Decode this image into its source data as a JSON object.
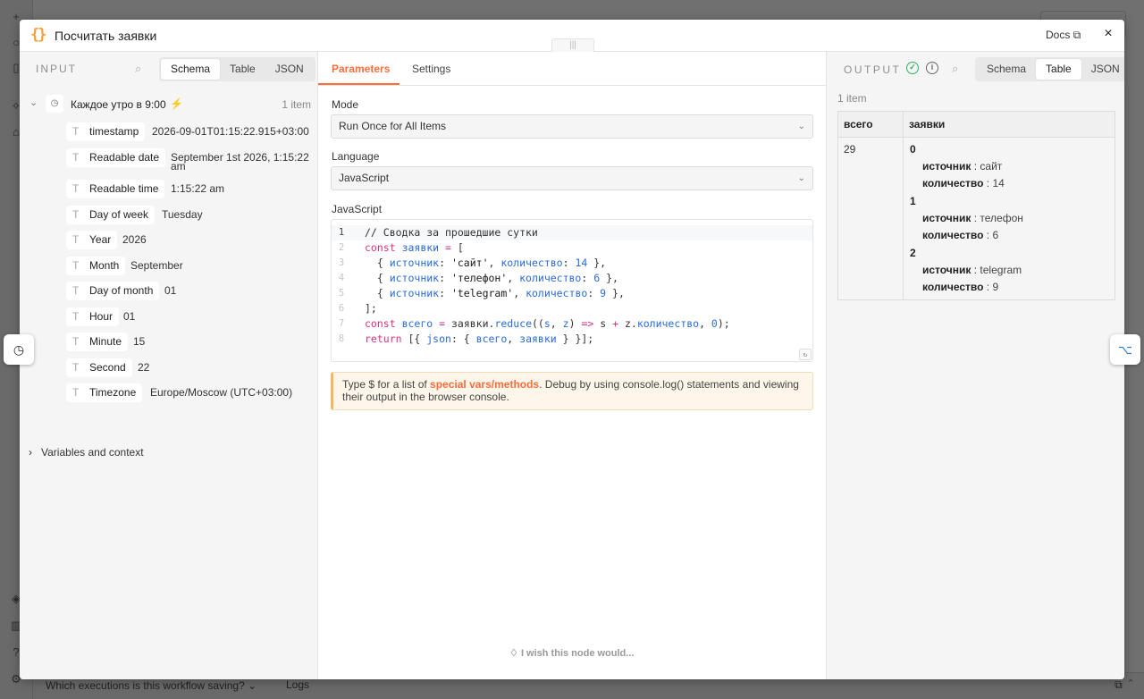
{
  "background": {
    "bottom_bar": {
      "executions_select": "Which executions is this workflow saving?",
      "logs_label": "Logs"
    }
  },
  "modal": {
    "node_icon": "{}",
    "title": "Посчитать заявки",
    "docs_label": "Docs",
    "close_icon": "×"
  },
  "input": {
    "label": "INPUT",
    "view_tabs": [
      "Schema",
      "Table",
      "JSON"
    ],
    "active_view": "Schema",
    "trigger": {
      "name": "Каждое утро в 9:00",
      "count": "1 item"
    },
    "fields": [
      {
        "key": "timestamp",
        "value": "2026-09-01T01:15:22.915+03:00"
      },
      {
        "key": "Readable date",
        "value": "September 1st 2026, 1:15:22",
        "value2": "am"
      },
      {
        "key": "Readable time",
        "value": "1:15:22 am"
      },
      {
        "key": "Day of week",
        "value": "Tuesday"
      },
      {
        "key": "Year",
        "value": "2026"
      },
      {
        "key": "Month",
        "value": "September"
      },
      {
        "key": "Day of month",
        "value": "01"
      },
      {
        "key": "Hour",
        "value": "01"
      },
      {
        "key": "Minute",
        "value": "15"
      },
      {
        "key": "Second",
        "value": "22"
      },
      {
        "key": "Timezone",
        "value": "Europe/Moscow (UTC+03:00)"
      }
    ],
    "variables_label": "Variables and context"
  },
  "params": {
    "tabs": [
      "Parameters",
      "Settings"
    ],
    "active_tab": "Parameters",
    "mode_label": "Mode",
    "mode_value": "Run Once for All Items",
    "language_label": "Language",
    "language_value": "JavaScript",
    "code_label": "JavaScript",
    "code_lines": [
      "// Сводка за прошедшие сутки",
      "const заявки = [",
      "  { источник: 'сайт', количество: 14 },",
      "  { источник: 'телефон', количество: 6 },",
      "  { источник: 'telegram', количество: 9 },",
      "];",
      "const всего = заявки.reduce((s, z) => s + z.количество, 0);",
      "return [{ json: { всего, заявки } }];"
    ],
    "hint": {
      "before": "Type $ for a list of ",
      "link": "special vars/methods",
      "after": ". Debug by using console.log() statements and viewing their output in the browser console."
    },
    "wish_label": "I wish this node would..."
  },
  "output": {
    "label": "OUTPUT",
    "view_tabs": [
      "Schema",
      "Table",
      "JSON"
    ],
    "active_view": "Table",
    "count": "1 item",
    "table": {
      "headers": [
        "всего",
        "заявки"
      ],
      "total": "29",
      "items": [
        {
          "index": "0",
          "source_key": "источник",
          "source": "сайт",
          "qty_key": "количество",
          "qty": "14"
        },
        {
          "index": "1",
          "source_key": "источник",
          "source": "телефон",
          "qty_key": "количество",
          "qty": "6"
        },
        {
          "index": "2",
          "source_key": "источник",
          "source": "telegram",
          "qty_key": "количество",
          "qty": "9"
        }
      ]
    }
  }
}
